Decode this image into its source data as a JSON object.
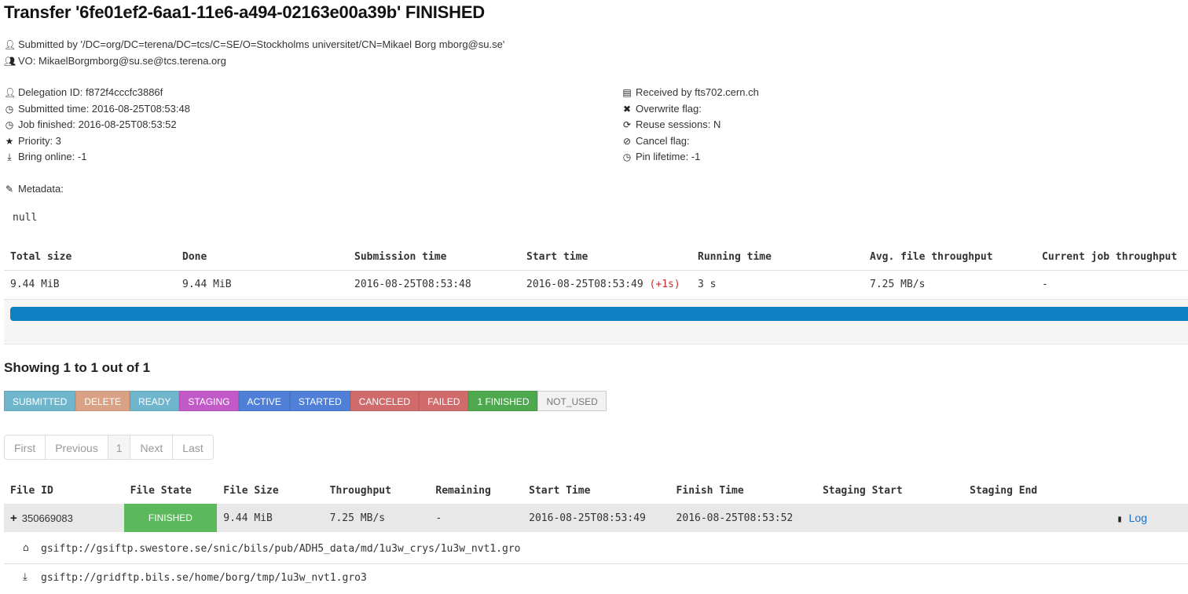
{
  "title": "Transfer '6fe01ef2-6aa1-11e6-a494-02163e00a39b' FINISHED",
  "submitter": {
    "submitted_by": "Submitted by '/DC=org/DC=terena/DC=tcs/C=SE/O=Stockholms universitet/CN=Mikael Borg mborg@su.se'",
    "vo": "VO: MikaelBorgmborg@su.se@tcs.terena.org"
  },
  "details_left": {
    "delegation": "Delegation ID: f872f4cccfc3886f",
    "submitted_time": "Submitted time: 2016-08-25T08:53:48",
    "job_finished": "Job finished: 2016-08-25T08:53:52",
    "priority": "Priority: 3",
    "bring_online": "Bring online: -1"
  },
  "details_right": {
    "received_by": "Received by fts702.cern.ch",
    "overwrite": "Overwrite flag:",
    "reuse": "Reuse sessions: N",
    "cancel": "Cancel flag:",
    "pin": "Pin lifetime: -1"
  },
  "metadata": {
    "label": "Metadata:",
    "value": "null"
  },
  "summary": {
    "headers": [
      "Total size",
      "Done",
      "Submission time",
      "Start time",
      "Running time",
      "Avg. file throughput",
      "Current job throughput"
    ],
    "values": {
      "total_size": "9.44 MiB",
      "done": "9.44 MiB",
      "submission_time": "2016-08-25T08:53:48",
      "start_time": "2016-08-25T08:53:49",
      "start_delta": "(+1s)",
      "running_time": "3 s",
      "avg_throughput": "7.25 MB/s",
      "current_throughput": "-"
    },
    "progress": 1.0,
    "progress_color": "#0e7fc1"
  },
  "showing": "Showing 1 to 1 out of 1",
  "states": [
    {
      "label": "SUBMITTED",
      "color": "#6fb5cc"
    },
    {
      "label": "DELETE",
      "color": "#d9a285"
    },
    {
      "label": "READY",
      "color": "#6fb5cc"
    },
    {
      "label": "STAGING",
      "color": "#c159c7"
    },
    {
      "label": "ACTIVE",
      "color": "#4f7fd6"
    },
    {
      "label": "STARTED",
      "color": "#4f7fd6"
    },
    {
      "label": "CANCELED",
      "color": "#d16b6b"
    },
    {
      "label": "FAILED",
      "color": "#d16b6b"
    },
    {
      "label": "1 FINISHED",
      "color": "#4ea94e"
    },
    {
      "label": "NOT_USED",
      "color": "#f2f2f2"
    }
  ],
  "pager": [
    "First",
    "Previous",
    "1",
    "Next",
    "Last"
  ],
  "files": {
    "headers": [
      "File ID",
      "File State",
      "File Size",
      "Throughput",
      "Remaining",
      "Start Time",
      "Finish Time",
      "Staging Start",
      "Staging End"
    ],
    "row": {
      "file_id": "350669083",
      "state": "FINISHED",
      "size": "9.44 MiB",
      "throughput": "7.25 MB/s",
      "remaining": "-",
      "start_time": "2016-08-25T08:53:49",
      "finish_time": "2016-08-25T08:53:52",
      "staging_start": "",
      "staging_end": "",
      "log": "Log"
    },
    "source": "gsiftp://gsiftp.swestore.se/snic/bils/pub/ADH5_data/md/1u3w_crys/1u3w_nvt1.gro",
    "destination": "gsiftp://gridftp.bils.se/home/borg/tmp/1u3w_nvt1.gro3"
  }
}
